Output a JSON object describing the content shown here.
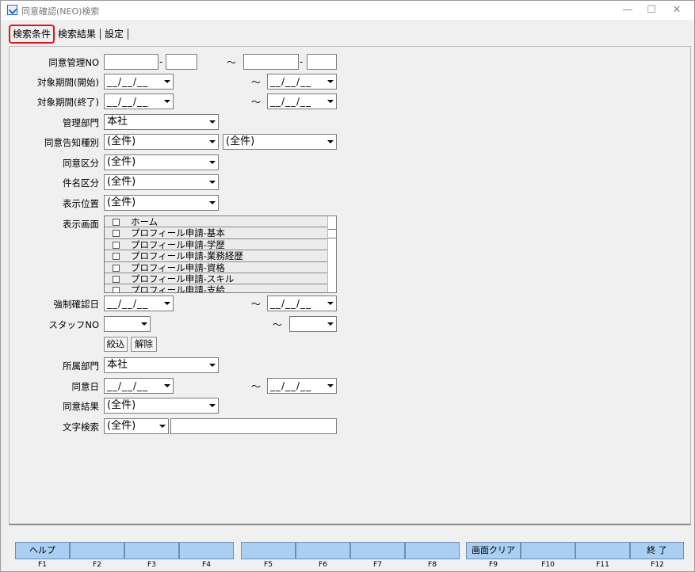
{
  "window": {
    "title": "同意確認(NEO)検索",
    "minimize_glyph": "—",
    "maximize_glyph": "☐",
    "close_glyph": "✕"
  },
  "tabs": [
    {
      "label": "検索条件",
      "active": true
    },
    {
      "label": "検索結果",
      "active": false
    },
    {
      "label": "設定",
      "active": false
    }
  ],
  "form": {
    "consent_mgmt_no": {
      "label": "同意管理NO",
      "sep_dash": "-",
      "tilde": "～"
    },
    "period_start": {
      "label": "対象期間(開始)",
      "from": "__/__/__",
      "to": "__/__/__",
      "tilde": "～"
    },
    "period_end": {
      "label": "対象期間(終了)",
      "from": "__/__/__",
      "to": "__/__/__",
      "tilde": "～"
    },
    "mgmt_dept": {
      "label": "管理部門",
      "value": "本社"
    },
    "notice_type": {
      "label": "同意告知種別",
      "value1": "(全件)",
      "value2": "(全件)"
    },
    "consent_class": {
      "label": "同意区分",
      "value": "(全件)"
    },
    "subject_class": {
      "label": "件名区分",
      "value": "(全件)"
    },
    "display_position": {
      "label": "表示位置",
      "value": "(全件)"
    },
    "display_screen": {
      "label": "表示画面",
      "items": [
        "ホーム",
        "プロフィール申請-基本",
        "プロフィール申請-学歴",
        "プロフィール申請-業務経歴",
        "プロフィール申請-資格",
        "プロフィール申請-スキル",
        "プロフィール申請-支給"
      ]
    },
    "forced_confirm_date": {
      "label": "強制確認日",
      "from": "__/__/__",
      "to": "__/__/__",
      "tilde": "～"
    },
    "staff_no": {
      "label": "スタッフNO",
      "tilde": "～"
    },
    "buttons": {
      "narrow": "絞込",
      "clear": "解除"
    },
    "affiliated_dept": {
      "label": "所属部門",
      "value": "本社"
    },
    "consent_date": {
      "label": "同意日",
      "from": "__/__/__",
      "to": "__/__/__",
      "tilde": "～"
    },
    "consent_result": {
      "label": "同意結果",
      "value": "(全件)"
    },
    "text_search": {
      "label": "文字検索",
      "value": "(全件)",
      "text": ""
    }
  },
  "function_keys": [
    {
      "key": "F1",
      "label": "ヘルプ"
    },
    {
      "key": "F2",
      "label": ""
    },
    {
      "key": "F3",
      "label": ""
    },
    {
      "key": "F4",
      "label": ""
    },
    {
      "key": "F5",
      "label": ""
    },
    {
      "key": "F6",
      "label": ""
    },
    {
      "key": "F7",
      "label": ""
    },
    {
      "key": "F8",
      "label": ""
    },
    {
      "key": "F9",
      "label": "画面クリア"
    },
    {
      "key": "F10",
      "label": ""
    },
    {
      "key": "F11",
      "label": ""
    },
    {
      "key": "F12",
      "label": "終 了"
    }
  ],
  "colors": {
    "fkey_bg": "#a9cff2",
    "active_tab_border": "#e0141e"
  }
}
